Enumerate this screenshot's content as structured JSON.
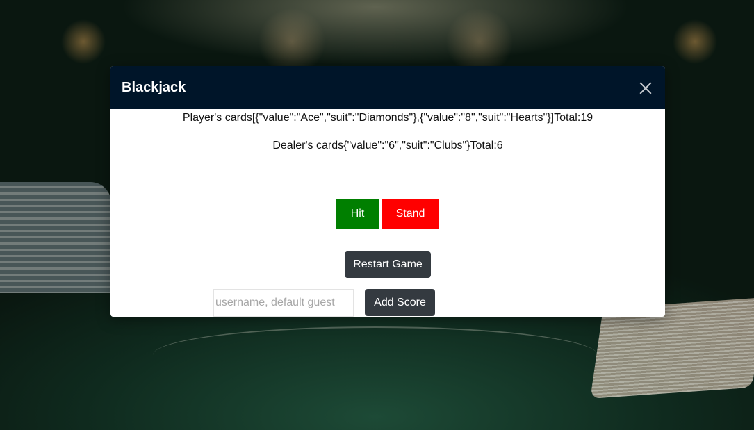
{
  "modal": {
    "title": "Blackjack",
    "close_icon": "close-x-icon"
  },
  "game": {
    "player_label": "Player's cards",
    "player_cards": "[{\"value\":\"Ace\",\"suit\":\"Diamonds\"},{\"value\":\"8\",\"suit\":\"Hearts\"}]",
    "player_total_label": "Total:",
    "player_total": "19",
    "dealer_label": "Dealer's cards",
    "dealer_cards": "{\"value\":\"6\",\"suit\":\"Clubs\"}",
    "dealer_total_label": "Total:",
    "dealer_total": "6"
  },
  "actions": {
    "hit_label": "Hit",
    "stand_label": "Stand",
    "restart_label": "Restart Game",
    "add_score_label": "Add Score"
  },
  "score": {
    "username_value": "",
    "username_placeholder": "username, default guest"
  },
  "colors": {
    "header_bg": "#001529",
    "hit": "#007f00",
    "stand": "#ff0000",
    "dark_button": "#343a40"
  }
}
